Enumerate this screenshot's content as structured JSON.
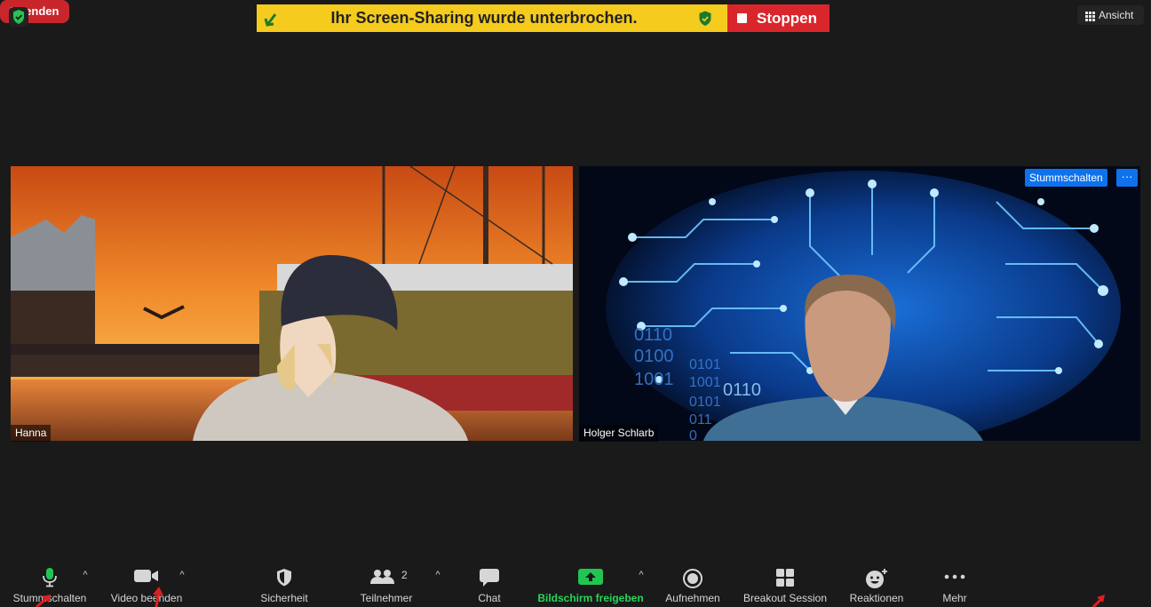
{
  "banner": {
    "text": "Ihr Screen-Sharing wurde unterbrochen.",
    "stop_label": "Stoppen",
    "color": "#f5cb1d",
    "stop_color": "#d9262c"
  },
  "view_button": {
    "label": "Ansicht",
    "icon": "grid-icon"
  },
  "participants": [
    {
      "name": "Hanna"
    },
    {
      "name": "Holger Schlarb",
      "mute_button": "Stummschalten",
      "more_button": "···"
    }
  ],
  "toolbar": {
    "mute": {
      "label": "Stummschalten",
      "icon": "microphone-icon"
    },
    "video": {
      "label": "Video beenden",
      "icon": "video-camera-icon"
    },
    "security": {
      "label": "Sicherheit",
      "icon": "shield-icon"
    },
    "participants": {
      "label": "Teilnehmer",
      "count": "2",
      "icon": "participants-icon"
    },
    "chat": {
      "label": "Chat",
      "icon": "chat-icon"
    },
    "share": {
      "label": "Bildschirm freigeben",
      "icon": "share-screen-icon",
      "color": "#23d959"
    },
    "record": {
      "label": "Aufnehmen",
      "icon": "record-icon"
    },
    "breakout": {
      "label": "Breakout Session",
      "icon": "breakout-icon"
    },
    "reactions": {
      "label": "Reaktionen",
      "icon": "reaction-icon"
    },
    "more": {
      "label": "Mehr",
      "icon": "more-dots-icon"
    },
    "end": {
      "label": "Beenden",
      "color": "#c8262b"
    }
  },
  "binary_text": [
    "0110",
    "0100",
    "1001",
    "0101",
    "1001",
    "0110",
    "0101",
    "011",
    "0"
  ]
}
